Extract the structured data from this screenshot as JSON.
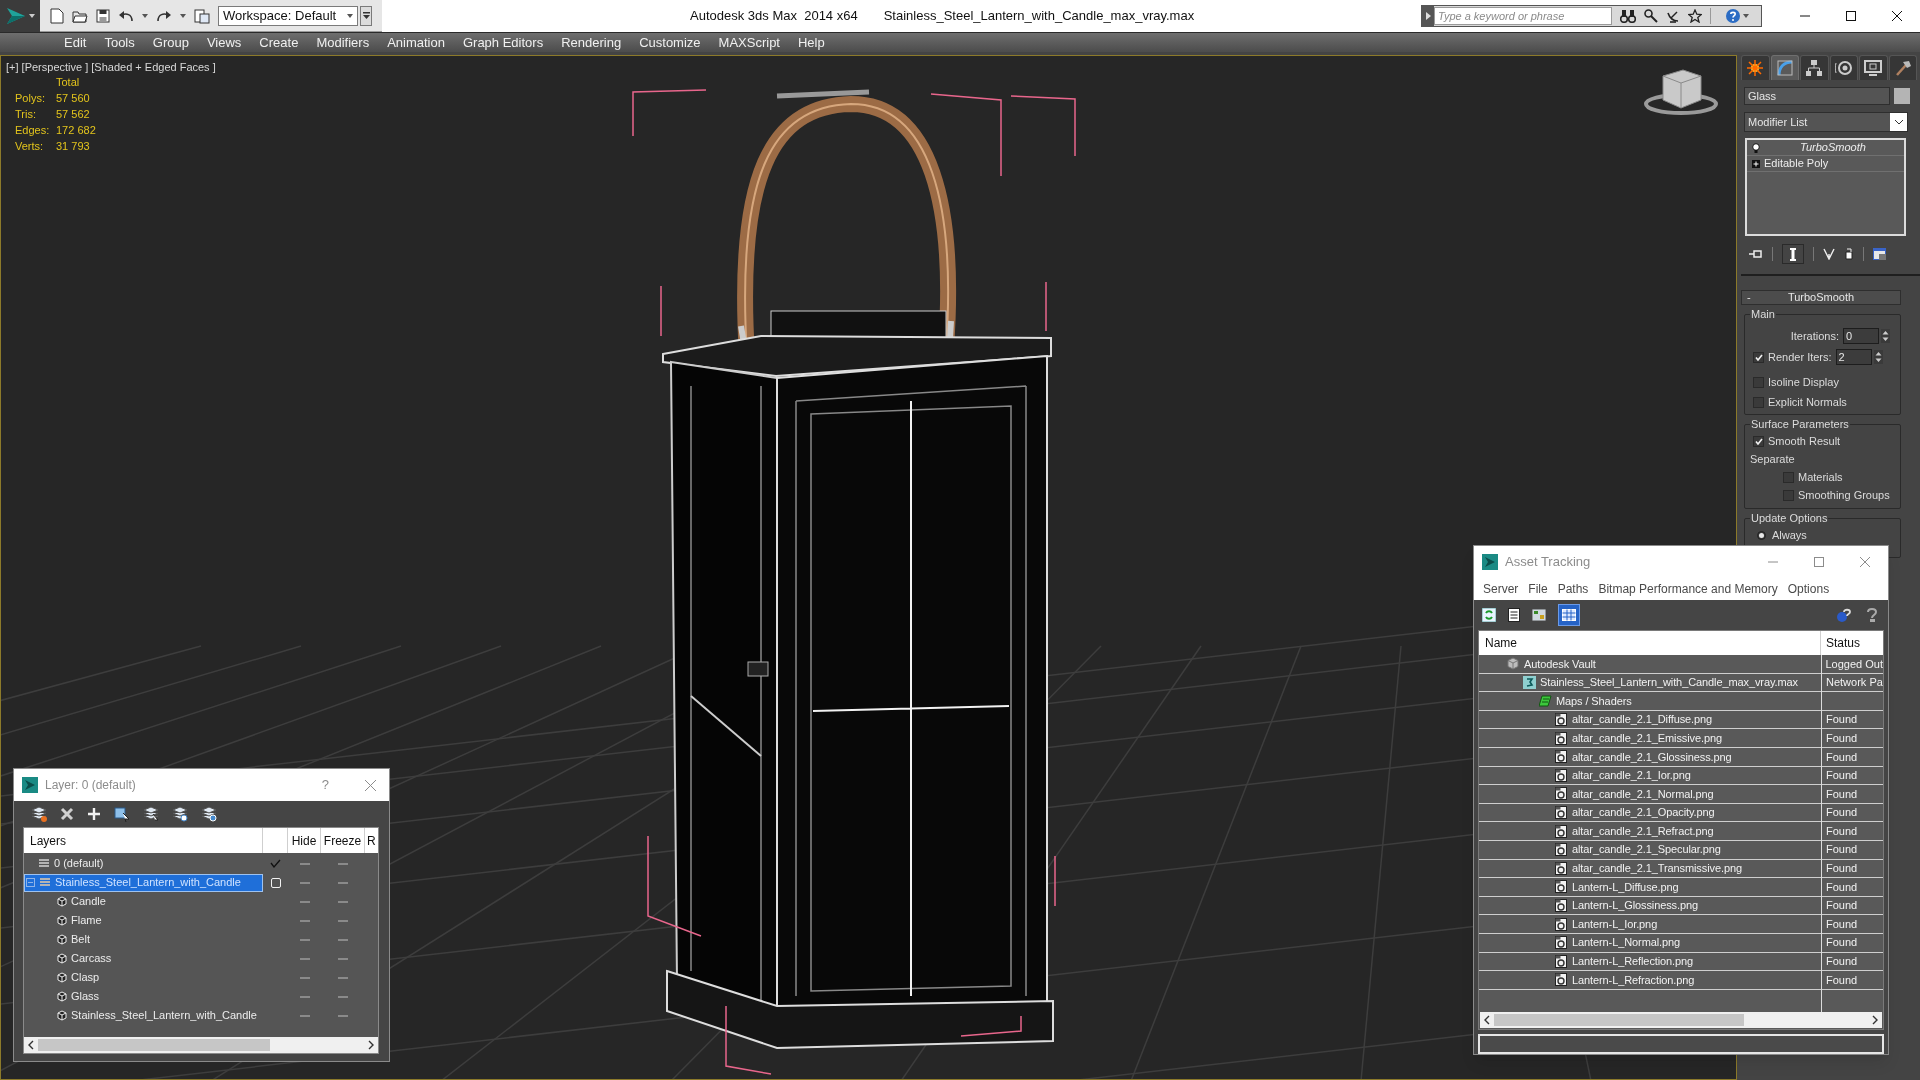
{
  "title_bar": {
    "workspace": "Workspace: Default",
    "app_title": "Autodesk 3ds Max  2014 x64",
    "file_title": "Stainless_Steel_Lantern_with_Candle_max_vray.max",
    "search": {
      "placeholder": "Type a keyword or phrase"
    }
  },
  "menu": [
    "Edit",
    "Tools",
    "Group",
    "Views",
    "Create",
    "Modifiers",
    "Animation",
    "Graph Editors",
    "Rendering",
    "Customize",
    "MAXScript",
    "Help"
  ],
  "viewport": {
    "label": "[+] [Perspective ] [Shaded + Edged Faces ]",
    "stats": {
      "header": "Total",
      "rows": [
        {
          "label": "Polys:",
          "value": "57 560"
        },
        {
          "label": "Tris:",
          "value": "57 562"
        },
        {
          "label": "Edges:",
          "value": "172 682"
        },
        {
          "label": "Verts:",
          "value": "31 793"
        }
      ]
    }
  },
  "command_panel": {
    "tabs": [
      {
        "kind": "create",
        "selected": false
      },
      {
        "kind": "modify",
        "selected": true
      },
      {
        "kind": "hierarchy",
        "selected": false
      },
      {
        "kind": "motion",
        "selected": false
      },
      {
        "kind": "display",
        "selected": false
      },
      {
        "kind": "utilities",
        "selected": false
      }
    ],
    "object_name": "Glass",
    "modifier_list": "Modifier List",
    "stack": [
      {
        "label": "TurboSmooth",
        "kind": "modifier"
      },
      {
        "label": "Editable Poly",
        "kind": "base"
      }
    ],
    "rollout": {
      "collapse_sign": "-",
      "title": "TurboSmooth",
      "main": {
        "label": "Main",
        "iterations": {
          "label": "Iterations:",
          "value": "0"
        },
        "render_iters": {
          "label": "Render Iters:",
          "value": "2",
          "checked": true
        },
        "options": [
          {
            "label": "Isoline Display",
            "checked": false
          },
          {
            "label": "Explicit Normals",
            "checked": false
          }
        ]
      },
      "surface": {
        "label": "Surface Parameters",
        "smooth_result": {
          "label": "Smooth Result",
          "checked": true
        },
        "separate": "Separate",
        "options": [
          {
            "label": "Materials",
            "checked": false
          },
          {
            "label": "Smoothing Groups",
            "checked": false
          }
        ]
      },
      "update": {
        "label": "Update Options",
        "options": [
          {
            "label": "Always",
            "selected": true
          }
        ]
      }
    }
  },
  "asset_tracking": {
    "title": "Asset Tracking",
    "menu": [
      "Server",
      "File",
      "Paths",
      "Bitmap Performance and Memory",
      "Options"
    ],
    "columns": [
      "Name",
      "Status"
    ],
    "rows": [
      {
        "kind": "vault",
        "name": "Autodesk Vault",
        "status": "Logged Out",
        "children": [
          {
            "kind": "scene",
            "name": "Stainless_Steel_Lantern_with_Candle_max_vray.max",
            "status": "Network Pa",
            "children": [
              {
                "kind": "folder",
                "name": "Maps / Shaders",
                "children": [
                  {
                    "kind": "bitmap",
                    "name": "altar_candle_2.1_Diffuse.png",
                    "status": "Found"
                  },
                  {
                    "kind": "bitmap",
                    "name": "altar_candle_2.1_Emissive.png",
                    "status": "Found"
                  },
                  {
                    "kind": "bitmap",
                    "name": "altar_candle_2.1_Glossiness.png",
                    "status": "Found"
                  },
                  {
                    "kind": "bitmap",
                    "name": "altar_candle_2.1_Ior.png",
                    "status": "Found"
                  },
                  {
                    "kind": "bitmap",
                    "name": "altar_candle_2.1_Normal.png",
                    "status": "Found"
                  },
                  {
                    "kind": "bitmap",
                    "name": "altar_candle_2.1_Opacity.png",
                    "status": "Found"
                  },
                  {
                    "kind": "bitmap",
                    "name": "altar_candle_2.1_Refract.png",
                    "status": "Found"
                  },
                  {
                    "kind": "bitmap",
                    "name": "altar_candle_2.1_Specular.png",
                    "status": "Found"
                  },
                  {
                    "kind": "bitmap",
                    "name": "altar_candle_2.1_Transmissive.png",
                    "status": "Found"
                  },
                  {
                    "kind": "bitmap",
                    "name": "Lantern-L_Diffuse.png",
                    "status": "Found"
                  },
                  {
                    "kind": "bitmap",
                    "name": "Lantern-L_Glossiness.png",
                    "status": "Found"
                  },
                  {
                    "kind": "bitmap",
                    "name": "Lantern-L_Ior.png",
                    "status": "Found"
                  },
                  {
                    "kind": "bitmap",
                    "name": "Lantern-L_Normal.png",
                    "status": "Found"
                  },
                  {
                    "kind": "bitmap",
                    "name": "Lantern-L_Reflection.png",
                    "status": "Found"
                  },
                  {
                    "kind": "bitmap",
                    "name": "Lantern-L_Refraction.png",
                    "status": "Found"
                  }
                ]
              }
            ]
          }
        ]
      }
    ]
  },
  "layer_dialog": {
    "title": "Layer: 0 (default)",
    "help": "?",
    "columns": [
      "Layers",
      "Hide",
      "Freeze",
      "R"
    ],
    "layers": [
      {
        "name": "0 (default)",
        "current": true,
        "selected": false
      },
      {
        "name": "Stainless_Steel_Lantern_with_Candle",
        "current": false,
        "selected": true,
        "expanded": true,
        "children": [
          {
            "name": "Candle"
          },
          {
            "name": "Flame"
          },
          {
            "name": "Belt"
          },
          {
            "name": "Carcass"
          },
          {
            "name": "Clasp"
          },
          {
            "name": "Glass"
          },
          {
            "name": "Stainless_Steel_Lantern_with_Candle"
          }
        ]
      }
    ]
  }
}
